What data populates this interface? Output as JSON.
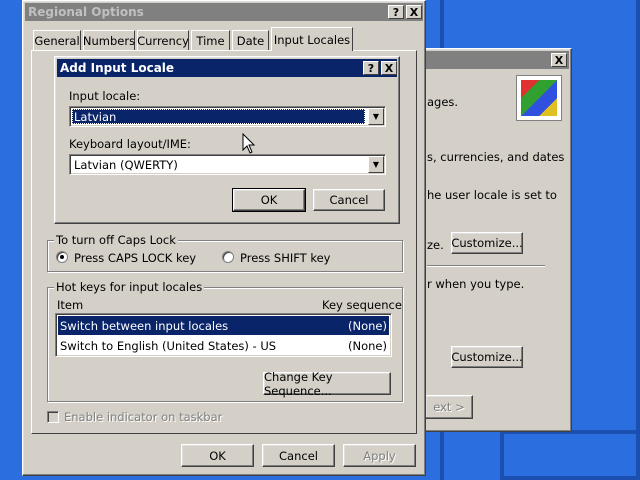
{
  "back_window": {
    "text_languages": "ages.",
    "text_currencies": "s, currencies, and dates",
    "text_user_locale": "he user locale is set to",
    "text_ze": "ze.",
    "customize_1": "Customize...",
    "text_when_type": "r when you type.",
    "customize_2": "Customize...",
    "text_ext": "ext >"
  },
  "regional_options": {
    "title": "Regional Options",
    "tabs": [
      "General",
      "Numbers",
      "Currency",
      "Time",
      "Date",
      "Input Locales"
    ],
    "caps_lock": {
      "legend": "To turn off Caps Lock",
      "option_caps": "Press CAPS LOCK key",
      "option_shift": "Press SHIFT key"
    },
    "hotkeys": {
      "legend": "Hot keys for input locales",
      "col_item": "Item",
      "col_key": "Key sequence",
      "rows": [
        {
          "item": "Switch between input locales",
          "key": "(None)"
        },
        {
          "item": "Switch to English (United States) - US",
          "key": "(None)"
        }
      ],
      "change_button": "Change Key Sequence..."
    },
    "enable_indicator": "Enable indicator on taskbar",
    "ok": "OK",
    "cancel": "Cancel",
    "apply": "Apply"
  },
  "add_locale": {
    "title": "Add Input Locale",
    "input_locale_label": "Input locale:",
    "input_locale_value": "Latvian",
    "keyboard_label": "Keyboard layout/IME:",
    "keyboard_value": "Latvian (QWERTY)",
    "ok": "OK",
    "cancel": "Cancel"
  },
  "title_buttons": {
    "help": "?",
    "close": "X"
  },
  "colors": {
    "desktop": "#2a6edf",
    "title_active": "#0a246a",
    "title_inactive": "#808080",
    "selection": "#0a246a"
  }
}
